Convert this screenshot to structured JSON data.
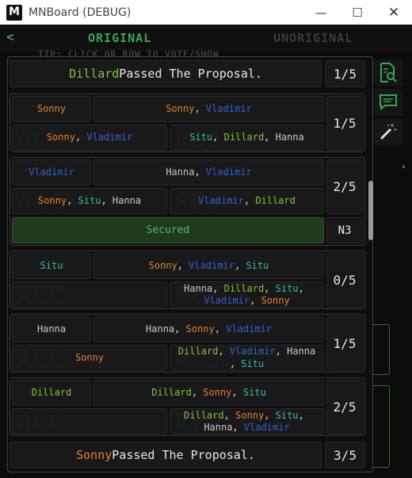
{
  "window": {
    "title": "MNBoard (DEBUG)",
    "minimize": "—",
    "maximize": "☐",
    "close": "✕"
  },
  "tabs": {
    "back": "<",
    "active": "ORIGINAL",
    "inactive": "UNORIGINAL",
    "tip": "TIP: CLICK OR ROW TO VOTE/SHOW"
  },
  "colors": {
    "Sonny": "#e0812f",
    "Vladimir": "#2f62d6",
    "Dillard": "#7cc43c",
    "Situ": "#2fbfa8",
    "Hanna": "#c8c8c8",
    "accent": "#3fa34d"
  },
  "watermarks": {
    "acc": "ACC",
    "rej": "REJ"
  },
  "header_result": {
    "name": "Dillard",
    "text": " Passed The Proposal.",
    "count": "1/5"
  },
  "footer_result": {
    "name": "Sonny",
    "text": " Passed The Proposal.",
    "count": "3/5"
  },
  "secured": {
    "label": "Secured",
    "code": "N3"
  },
  "rounds": [
    {
      "leader": "Sonny",
      "team": [
        "Sonny",
        "Vladimir"
      ],
      "accept": [
        "Sonny",
        "Vladimir"
      ],
      "reject": [
        "Situ",
        "Dillard",
        "Hanna"
      ],
      "count": "1/5"
    },
    {
      "leader": "Vladimir",
      "team": [
        "Hanna",
        "Vladimir"
      ],
      "accept": [
        "Sonny",
        "Situ",
        "Hanna"
      ],
      "reject": [
        "Vladimir",
        "Dillard"
      ],
      "count": "2/5"
    },
    {
      "leader": "Situ",
      "team": [
        "Sonny",
        "Vladimir",
        "Situ"
      ],
      "accept": [],
      "reject": [
        "Hanna",
        "Dillard",
        "Situ",
        "Vladimir",
        "Sonny"
      ],
      "count": "0/5"
    },
    {
      "leader": "Hanna",
      "team": [
        "Hanna",
        "Sonny",
        "Vladimir"
      ],
      "accept": [
        "Sonny"
      ],
      "reject": [
        "Dillard",
        "Vladimir",
        "Hanna",
        "Situ"
      ],
      "count": "1/5"
    },
    {
      "leader": "Dillard",
      "team": [
        "Dillard",
        "Sonny",
        "Situ"
      ],
      "accept": [],
      "reject": [
        "Dillard",
        "Sonny",
        "Situ",
        "Hanna",
        "Vladimir"
      ],
      "count": "2/5"
    }
  ]
}
